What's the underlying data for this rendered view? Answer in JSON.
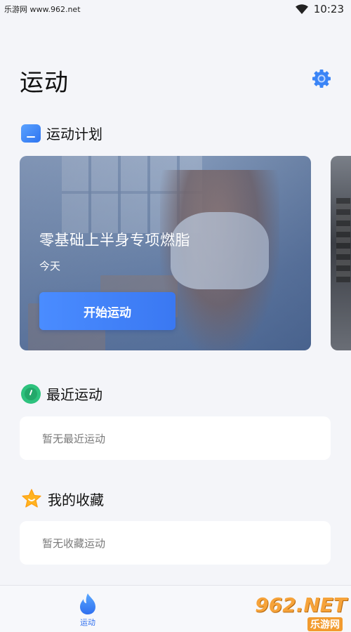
{
  "status_bar": {
    "watermark": "乐游网 www.962.net",
    "time": "10:23",
    "wifi_icon": "wifi-icon"
  },
  "header": {
    "title": "运动",
    "settings_icon": "gear-icon",
    "accent": "#3a84f6"
  },
  "plan_section": {
    "label": "运动计划",
    "card": {
      "title": "零基础上半身专项燃脂",
      "date": "今天",
      "button": "开始运动"
    }
  },
  "recent_section": {
    "label": "最近运动",
    "empty_text": "暂无最近运动"
  },
  "favorites_section": {
    "label": "我的收藏",
    "empty_text": "暂无收藏运动"
  },
  "bottom_nav": {
    "items": [
      {
        "label": "运动",
        "icon": "flame-icon",
        "active": true
      }
    ],
    "watermark_logo": "962.NET",
    "watermark_sub": "乐游网"
  }
}
